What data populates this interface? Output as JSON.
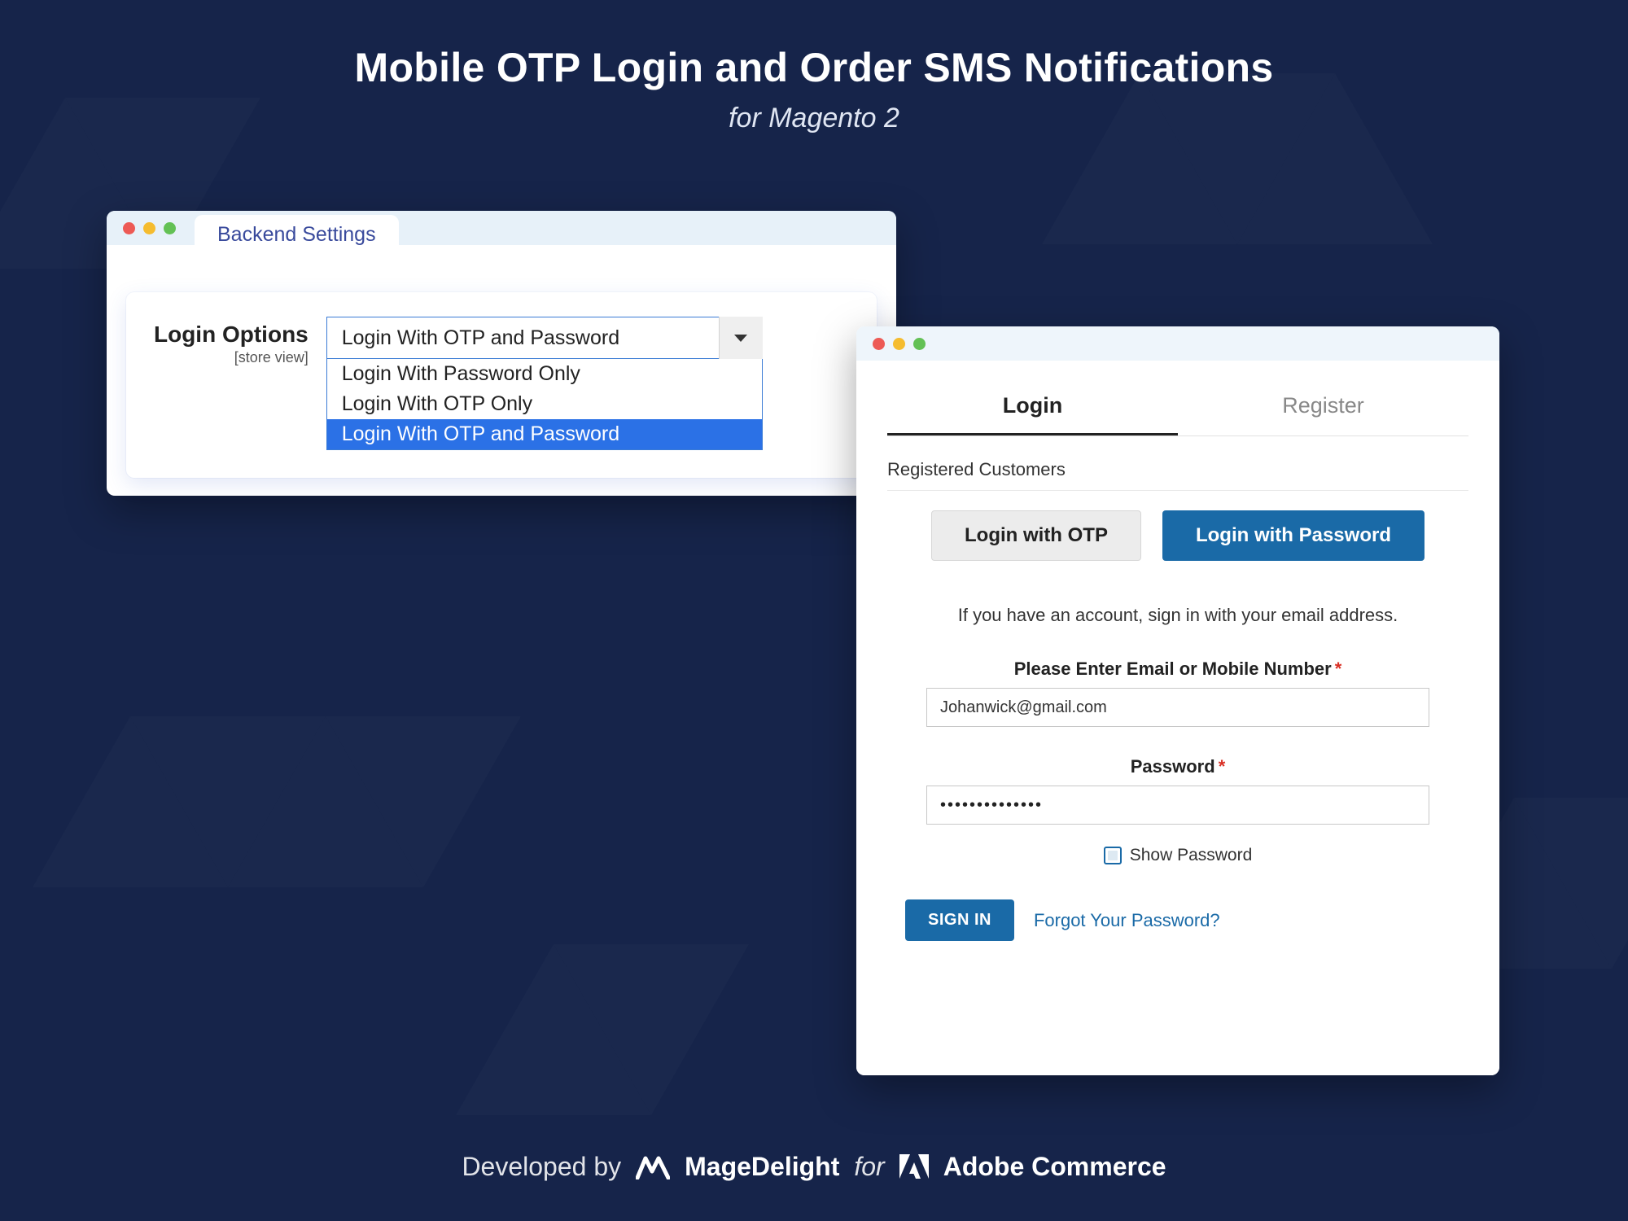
{
  "hero": {
    "title": "Mobile OTP Login and Order SMS Notifications",
    "subtitle": "for Magento 2"
  },
  "backend": {
    "tab_label": "Backend Settings",
    "field_label": "Login Options",
    "field_scope": "[store view]",
    "selected": "Login With OTP and Password",
    "options": [
      "Login With Password Only",
      "Login With OTP Only",
      "Login With OTP and Password"
    ],
    "selected_index": 2
  },
  "front": {
    "tabs": {
      "login": "Login",
      "register": "Register"
    },
    "section_title": "Registered Customers",
    "toggle": {
      "otp": "Login with OTP",
      "pwd": "Login with Password"
    },
    "help": "If you have an account, sign in with your email address.",
    "email_label": "Please Enter Email or Mobile Number",
    "email_value": "Johanwick@gmail.com",
    "password_label": "Password",
    "password_masked": "••••••••••••••",
    "show_password_label": "Show Password",
    "signin": "SIGN IN",
    "forgot": "Forgot Your Password?"
  },
  "footer": {
    "developed_by": "Developed by",
    "brand1": "MageDelight",
    "for": "for",
    "brand2": "Adobe Commerce"
  }
}
